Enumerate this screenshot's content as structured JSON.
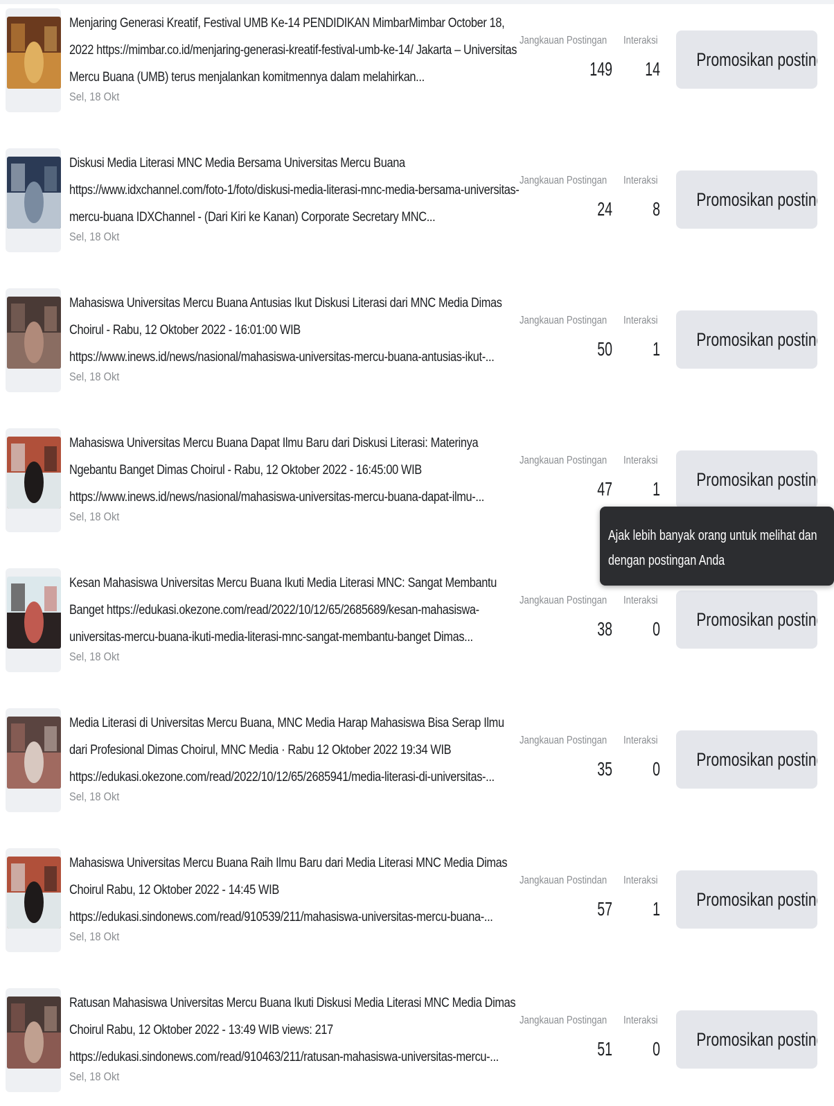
{
  "posts": [
    {
      "text": "Menjaring Generasi Kreatif, Festival UMB Ke-14 PENDIDIKAN MimbarMimbar October 18, 2022 https://mimbar.co.id/menjaring-generasi-kreatif-festival-umb-ke-14/ Jakarta – Universitas Mercu Buana (UMB) terus menjalankan komitmennya dalam melahirkan...",
      "date": "Sel, 18 Okt",
      "reach_label": "Jangkauan Postingan",
      "interaction_label": "Interaksi",
      "reach": "149",
      "interactions": "14",
      "promote_label": "Promosikan postingan",
      "thumb_colors": [
        "#6b3a1e",
        "#c98a3c",
        "#e0b060"
      ]
    },
    {
      "text": "Diskusi Media Literasi MNC Media Bersama Universitas Mercu Buana https://www.idxchannel.com/foto-1/foto/diskusi-media-literasi-mnc-media-bersama-universitas-mercu-buana IDXChannel - (Dari Kiri ke Kanan) Corporate Secretary MNC...",
      "date": "Sel, 18 Okt",
      "reach_label": "Jangkauan Postingan",
      "interaction_label": "Interaksi",
      "reach": "24",
      "interactions": "8",
      "promote_label": "Promosikan postingan",
      "thumb_colors": [
        "#2b3a55",
        "#b9c4d0",
        "#7a8ba0"
      ]
    },
    {
      "text": "Mahasiswa Universitas Mercu Buana Antusias Ikut Diskusi Literasi dari MNC Media Dimas Choirul - Rabu, 12 Oktober 2022 - 16:01:00 WIB https://www.inews.id/news/nasional/mahasiswa-universitas-mercu-buana-antusias-ikut-...",
      "date": "Sel, 18 Okt",
      "reach_label": "Jangkauan Postingan",
      "interaction_label": "Interaksi",
      "reach": "50",
      "interactions": "1",
      "promote_label": "Promosikan postingan",
      "thumb_colors": [
        "#4a3a36",
        "#8a6d62",
        "#b08a7a"
      ]
    },
    {
      "text": "Mahasiswa Universitas Mercu Buana Dapat Ilmu Baru dari Diskusi Literasi: Materinya Ngebantu Banget Dimas Choirul - Rabu, 12 Oktober 2022 - 16:45:00 WIB https://www.inews.id/news/nasional/mahasiswa-universitas-mercu-buana-dapat-ilmu-...",
      "date": "Sel, 18 Okt",
      "reach_label": "Jangkauan Postingan",
      "interaction_label": "Interaksi",
      "reach": "47",
      "interactions": "1",
      "promote_label": "Promosikan postingan",
      "thumb_colors": [
        "#b0503a",
        "#dfe6e8",
        "#1e1a1a"
      ]
    },
    {
      "text": "Kesan Mahasiswa Universitas Mercu Buana Ikuti Media Literasi MNC: Sangat Membantu Banget https://edukasi.okezone.com/read/2022/10/12/65/2685689/kesan-mahasiswa-universitas-mercu-buana-ikuti-media-literasi-mnc-sangat-membantu-banget Dimas...",
      "date": "Sel, 18 Okt",
      "reach_label": "Jangkauan Postingan",
      "interaction_label": "Interaksi",
      "reach": "38",
      "interactions": "0",
      "promote_label": "Promosikan postingan",
      "thumb_colors": [
        "#dce8ec",
        "#2a2222",
        "#c05a50"
      ]
    },
    {
      "text": "Media Literasi di Universitas Mercu Buana, MNC Media Harap Mahasiswa Bisa Serap Ilmu dari Profesional Dimas Choirul, MNC Media · Rabu 12 Oktober 2022 19:34 WIB https://edukasi.okezone.com/read/2022/10/12/65/2685941/media-literasi-di-universitas-...",
      "date": "Sel, 18 Okt",
      "reach_label": "Jangkauan Postingan",
      "interaction_label": "Interaksi",
      "reach": "35",
      "interactions": "0",
      "promote_label": "Promosikan postingan",
      "thumb_colors": [
        "#5a4440",
        "#a06a60",
        "#d8c8c0"
      ]
    },
    {
      "text": "Mahasiswa Universitas Mercu Buana Raih Ilmu Baru dari Media Literasi MNC Media Dimas Choirul Rabu, 12 Oktober 2022 - 14:45 WIB https://edukasi.sindonews.com/read/910539/211/mahasiswa-universitas-mercu-buana-...",
      "date": "Sel, 18 Okt",
      "reach_label": "Jangkauan Postindan",
      "interaction_label": "Interaksi",
      "reach": "57",
      "interactions": "1",
      "promote_label": "Promosikan postingan",
      "thumb_colors": [
        "#b0503a",
        "#dfe6e8",
        "#1e1a1a"
      ]
    },
    {
      "text": "Ratusan Mahasiswa Universitas Mercu Buana Ikuti Diskusi Media Literasi MNC Media Dimas Choirul Rabu, 12 Oktober 2022 - 13:49 WIB views: 217 https://edukasi.sindonews.com/read/910463/211/ratusan-mahasiswa-universitas-mercu-...",
      "date": "Sel, 18 Okt",
      "reach_label": "Jangkauan Postingan",
      "interaction_label": "Interaksi",
      "reach": "51",
      "interactions": "0",
      "promote_label": "Promosikan postingan",
      "thumb_colors": [
        "#4a3a36",
        "#8a5a52",
        "#c0a090"
      ]
    }
  ],
  "tooltip": {
    "text": "Ajak lebih banyak orang untuk melihat dan dengan postingan Anda"
  },
  "colors": {
    "button_bg": "#e4e6eb",
    "tooltip_bg": "#2c2d30",
    "secondary_text": "#8a8d91"
  }
}
